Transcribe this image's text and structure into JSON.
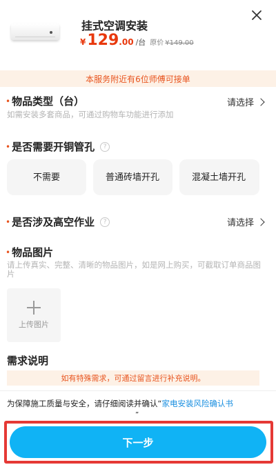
{
  "product": {
    "title": "挂式空调安装",
    "currency": "¥",
    "price_int": "129",
    "price_dec": ".00",
    "unit": "/台",
    "orig_label": "原价",
    "orig_price": "¥149.00"
  },
  "notice": "本服务附近有6位师傅可接单",
  "fields": {
    "item_type": {
      "required_mark": "•",
      "label": "物品类型（台）",
      "hint": "如需安装多套商品，可通过购物车功能进行添加",
      "select_label": "请选择"
    },
    "copper_hole": {
      "required_mark": "•",
      "label": "是否需要开铜管孔",
      "help_icon": "?",
      "options": [
        "不需要",
        "普通砖墙开孔",
        "混凝土墙开孔"
      ]
    },
    "high_altitude": {
      "required_mark": "•",
      "label": "是否涉及高空作业",
      "help_icon": "?",
      "select_label": "请选择"
    },
    "photos": {
      "required_mark": "•",
      "label": "物品图片",
      "hint": "请上传真实、完整、清晰的物品图片，如是网上购买，可截取订单商品图片",
      "upload_label": "上传图片"
    },
    "requirements": {
      "label": "需求说明",
      "remark": "如有特殊需求，可通过留言进行补充说明。"
    }
  },
  "agreement": {
    "text": "为保障施工质量与安全，请仔细阅读并确认“",
    "link": "家电安装风险确认书",
    "close_quote": "”"
  },
  "next_button": "下一步",
  "colors": {
    "accent_orange": "#e8541e",
    "price_red": "#e8380d",
    "primary_blue": "#10b3f5",
    "link_blue": "#1a8fe0",
    "highlight_red": "#e53935"
  },
  "icons": [
    "close-icon",
    "chevron-right-icon",
    "help-icon",
    "plus-icon"
  ]
}
